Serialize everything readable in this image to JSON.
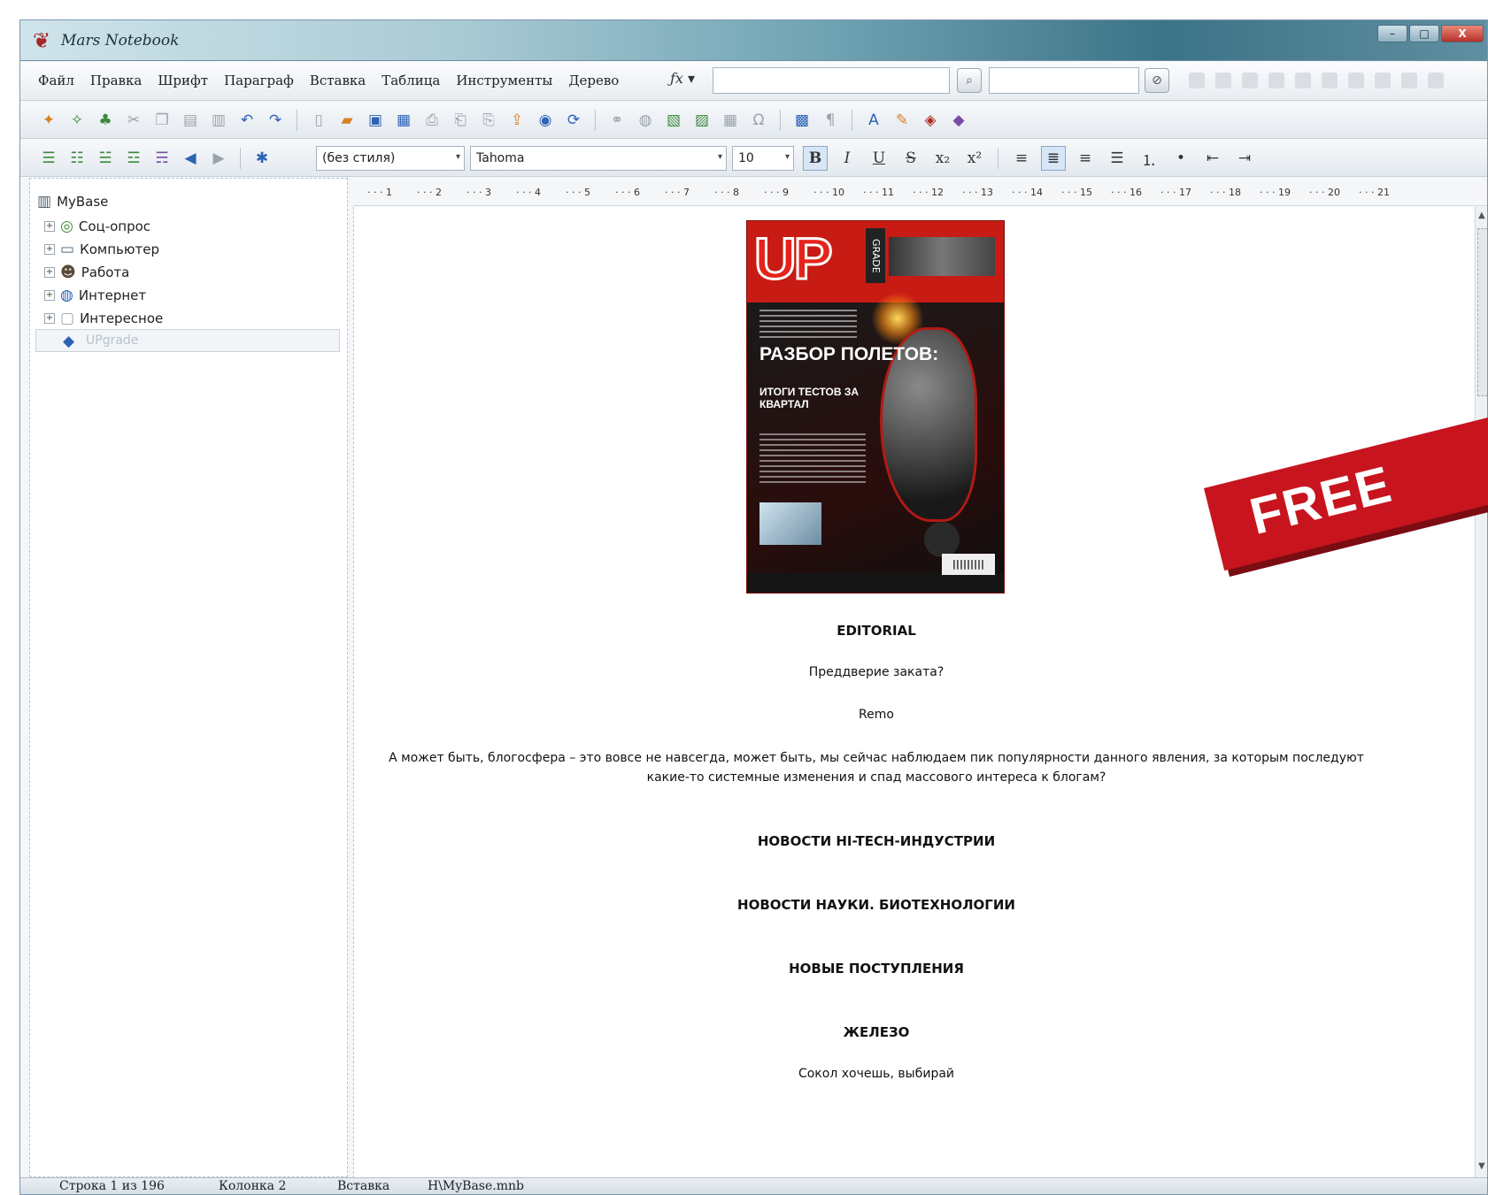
{
  "window": {
    "title": "Mars Notebook",
    "controls": {
      "minimize": "–",
      "maximize": "□",
      "close": "X"
    }
  },
  "menu": {
    "items": [
      "Файл",
      "Правка",
      "Шрифт",
      "Параграф",
      "Вставка",
      "Таблица",
      "Инструменты",
      "Дерево"
    ]
  },
  "search": {
    "label": "ƒx ▾"
  },
  "format_toolbar": {
    "style": "(без стиля)",
    "font": "Tahoma",
    "size": "10",
    "bold": "B",
    "italic": "I",
    "underline": "U",
    "strike": "S"
  },
  "tree": {
    "root": "MyBase",
    "items": [
      "Соц-опрос",
      "Компьютер",
      "Работа",
      "Интернет",
      "Интересное"
    ],
    "selected": "UPgrade"
  },
  "ruler": {
    "ticks": [
      "1",
      "2",
      "3",
      "4",
      "5",
      "6",
      "7",
      "8",
      "9",
      "10",
      "11",
      "12",
      "13",
      "14",
      "15",
      "16",
      "17",
      "18",
      "19",
      "20",
      "21"
    ]
  },
  "cover": {
    "logo": "UP",
    "logo_sub": "GRADE",
    "headline": "РАЗБОР ПОЛЕТОВ:",
    "headline_sub": "ИТОГИ ТЕСТОВ ЗА КВАРТАЛ"
  },
  "document": {
    "editorial": "EDITORIAL",
    "subtitle": "Преддверие заката?",
    "author": "Remo",
    "body": "А может быть, блогосфера – это вовсе не навсегда, может быть, мы сейчас наблюдаем пик популярности данного явления, за которым последуют какие-то системные изменения и спад массового интереса к блогам?",
    "news_hitech": "НОВОСТИ HI-TECH-ИНДУСТРИИ",
    "news_science": "НОВОСТИ НАУКИ. БИОТЕХНОЛОГИИ",
    "new_arrivals": "НОВЫЕ ПОСТУПЛЕНИЯ",
    "hardware": "ЖЕЛЕЗО",
    "choose": "Сокол хочешь, выбирай"
  },
  "banner": {
    "text": "FREE"
  },
  "status": {
    "line": "Строка 1 из 196",
    "column": "Колонка 2",
    "mode": "Вставка",
    "file": "Н\\MyBase.mnb"
  },
  "colors": {
    "accent_red": "#c8141e",
    "titlebar_dark": "#3c7387"
  }
}
